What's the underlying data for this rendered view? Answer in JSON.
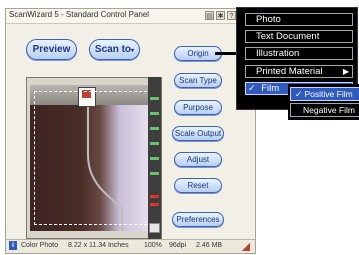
{
  "window": {
    "title": "ScanWizard 5 - Standard Control Panel"
  },
  "titlebar_icons": [
    "scanner-icon",
    "tools-icon",
    "help-icon",
    "minimize-icon"
  ],
  "titlebar_glyphs": {
    "help": "?",
    "minimize": "_"
  },
  "toolbar": {
    "preview_label": "Preview",
    "scan_to_label": "Scan to"
  },
  "side_buttons": {
    "original": "Origin",
    "scan_type": "Scan Type",
    "purpose": "Purpose",
    "scale_output": "Scale Output",
    "adjust": "Adjust",
    "reset": "Reset",
    "preferences": "Preferences"
  },
  "status": {
    "info_icon": "i",
    "type": "Color Photo",
    "dimensions": "8.22 x 11.34 Inches",
    "scale": "100%",
    "resolution": "96dpi",
    "size": "2.46 MB"
  },
  "original_menu": {
    "items": [
      "Photo",
      "Text Document",
      "Illustration",
      "Printed Material",
      "Film"
    ],
    "selected": "Film",
    "check_glyph": "✓",
    "arrow_glyph": "▶"
  },
  "film_menu": {
    "items": [
      "Positive Film",
      "Negative Film"
    ],
    "selected": "Positive Film",
    "check_glyph": "✓"
  },
  "colors": {
    "accent": "#2f5bbf",
    "menu_bg": "#000000",
    "button_border": "#3b64b3"
  }
}
